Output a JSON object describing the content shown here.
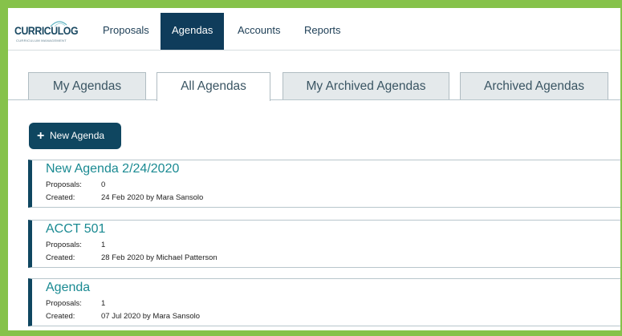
{
  "logo": {
    "text": "CURRICULOG",
    "subtitle": "CURRICULUM MANAGEMENT"
  },
  "nav": [
    {
      "label": "Proposals",
      "active": false
    },
    {
      "label": "Agendas",
      "active": true
    },
    {
      "label": "Accounts",
      "active": false
    },
    {
      "label": "Reports",
      "active": false
    }
  ],
  "tabs": [
    {
      "label": "My Agendas",
      "active": false
    },
    {
      "label": "All Agendas",
      "active": true
    },
    {
      "label": "My Archived Agendas",
      "active": false
    },
    {
      "label": "Archived Agendas",
      "active": false
    }
  ],
  "new_agenda_button": {
    "label": "New Agenda",
    "icon": "plus-icon"
  },
  "labels": {
    "proposals": "Proposals:",
    "created": "Created:"
  },
  "agendas": [
    {
      "title": "New Agenda 2/24/2020",
      "proposals": "0",
      "created": "24 Feb 2020 by Mara Sansolo"
    },
    {
      "title": "ACCT 501",
      "proposals": "1",
      "created": "28 Feb 2020 by Michael Patterson"
    },
    {
      "title": "Agenda",
      "proposals": "1",
      "created": "07 Jul 2020 by Mara Sansolo"
    }
  ],
  "colors": {
    "accent_navy": "#0f3c5b",
    "title_teal": "#1a8a92",
    "frame_green": "#86c24a"
  }
}
